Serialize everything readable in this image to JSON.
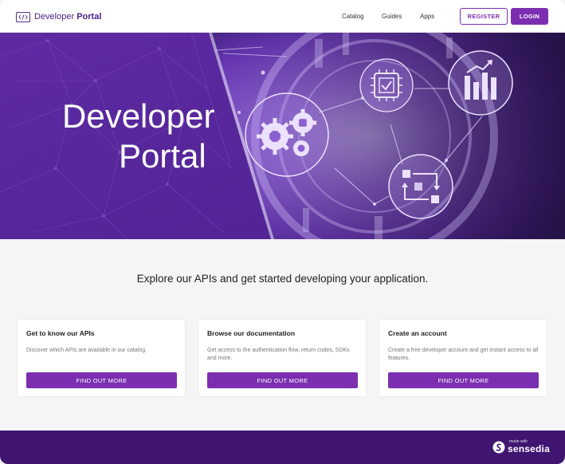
{
  "header": {
    "logo_icon": "code-brackets-icon",
    "brand_prefix": "Developer ",
    "brand_suffix": "Portal",
    "nav": [
      "Catalog",
      "Guides",
      "Apps"
    ],
    "register_label": "REGISTER",
    "login_label": "LOGIN"
  },
  "hero": {
    "title_line1": "Developer",
    "title_line2": "Portal",
    "icons": [
      "gears-icon",
      "chip-check-icon",
      "bar-chart-icon",
      "workflow-icon"
    ]
  },
  "main": {
    "tagline": "Explore our APIs and get started developing your application.",
    "cards": [
      {
        "title": "Get to know our APIs",
        "description": "Discover which APIs are available in our catalog.",
        "button": "FIND OUT MORE"
      },
      {
        "title": "Browse our documentation",
        "description": "Get access to the authentication flow, return codes, SDKs and more.",
        "button": "FIND OUT MORE"
      },
      {
        "title": "Create an account",
        "description": "Create a free developer account and get instant access to all features.",
        "button": "FIND OUT MORE"
      }
    ]
  },
  "footer": {
    "made_with": "made with",
    "brand": "sensedia",
    "brand_icon": "sensedia-logo-icon"
  },
  "colors": {
    "primary": "#7b2fb0",
    "hero": "#5b2b9c",
    "footer": "#3f1571"
  }
}
